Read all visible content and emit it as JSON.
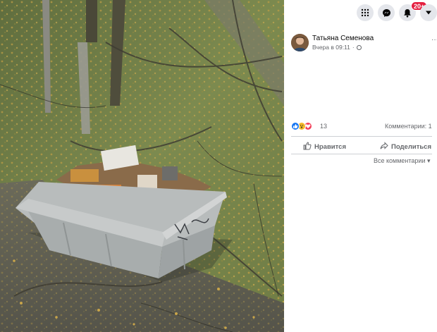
{
  "viewer": {
    "image_alt": "Мусорный контейнер среди опавших листьев"
  },
  "topbar": {
    "menu_icon": "grid-menu-icon",
    "messenger_icon": "messenger-icon",
    "notifications_icon": "bell-icon",
    "notifications_badge": "20+",
    "account_icon": "caret-down-icon",
    "badge_color": "#e41e3f"
  },
  "post": {
    "author": "Татьяна Семенова",
    "time": "Вчера в 09:11",
    "privacy_icon": "globe-icon",
    "more_icon": "ellipsis-icon",
    "more_label": "···"
  },
  "reactions": {
    "icons": [
      "like-icon",
      "wow-icon",
      "love-icon"
    ],
    "count": "13",
    "comments_label": "Комментарии: 1"
  },
  "actions": {
    "like_label": "Нравится",
    "share_label": "Поделиться",
    "all_comments_label": "Все комментарии"
  }
}
